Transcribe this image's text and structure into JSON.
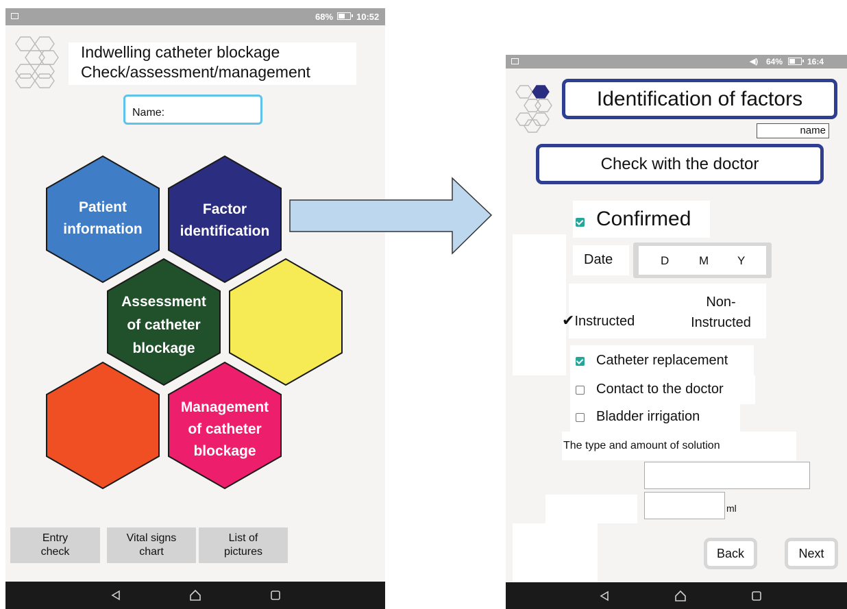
{
  "left_screen": {
    "status_bar": {
      "battery_percent": "68%",
      "time": "10:52"
    },
    "title_line1": "Indwelling catheter blockage",
    "title_line2": "Check/assessment/management",
    "name_label": "Name:",
    "hexagons": [
      {
        "line1": "Patient",
        "line2": "information",
        "color": "#3f7dc6"
      },
      {
        "line1": "Factor",
        "line2": "identification",
        "color": "#2b2d80"
      },
      {
        "line1": "Assessment",
        "line2": "of catheter",
        "line3": "blockage",
        "color": "#21512b"
      },
      {
        "color": "#f6ea55"
      },
      {
        "color": "#f04e23"
      },
      {
        "line1": "Management",
        "line2": "of catheter",
        "line3": "blockage",
        "color": "#ed1e6c"
      }
    ],
    "bottom_buttons": [
      {
        "line1": "Entry",
        "line2": "check"
      },
      {
        "line1": "Vital signs",
        "line2": "chart"
      },
      {
        "line1": "List of",
        "line2": "pictures"
      }
    ]
  },
  "arrow": {
    "color": "#bdd7ee"
  },
  "right_screen": {
    "status_bar": {
      "battery_percent": "64%",
      "time": "16:4"
    },
    "title": "Identification of factors",
    "name_label": "name",
    "check_with_doctor": "Check with the doctor",
    "confirmed_label": "Confirmed",
    "confirmed_checked": true,
    "date_label": "Date",
    "date_parts": {
      "day": "D",
      "month": "M",
      "year": "Y"
    },
    "instructed_label": "Instructed",
    "instructed_checkmark": "✔",
    "non_instructed_line1": "Non-",
    "non_instructed_line2": "Instructed",
    "options": [
      {
        "label": "Catheter replacement",
        "checked": true
      },
      {
        "label": "Contact to the doctor",
        "checked": false
      },
      {
        "label": "Bladder irrigation",
        "checked": false
      }
    ],
    "solution_label": "The type and amount of solution",
    "solution_type_value": "",
    "solution_amount_value": "",
    "unit_label": "ml",
    "back_label": "Back",
    "next_label": "Next"
  },
  "colors": {
    "accent_blue": "#2e3f92",
    "checkbox_teal": "#26a69a",
    "name_field_border": "#5ec3e8"
  }
}
